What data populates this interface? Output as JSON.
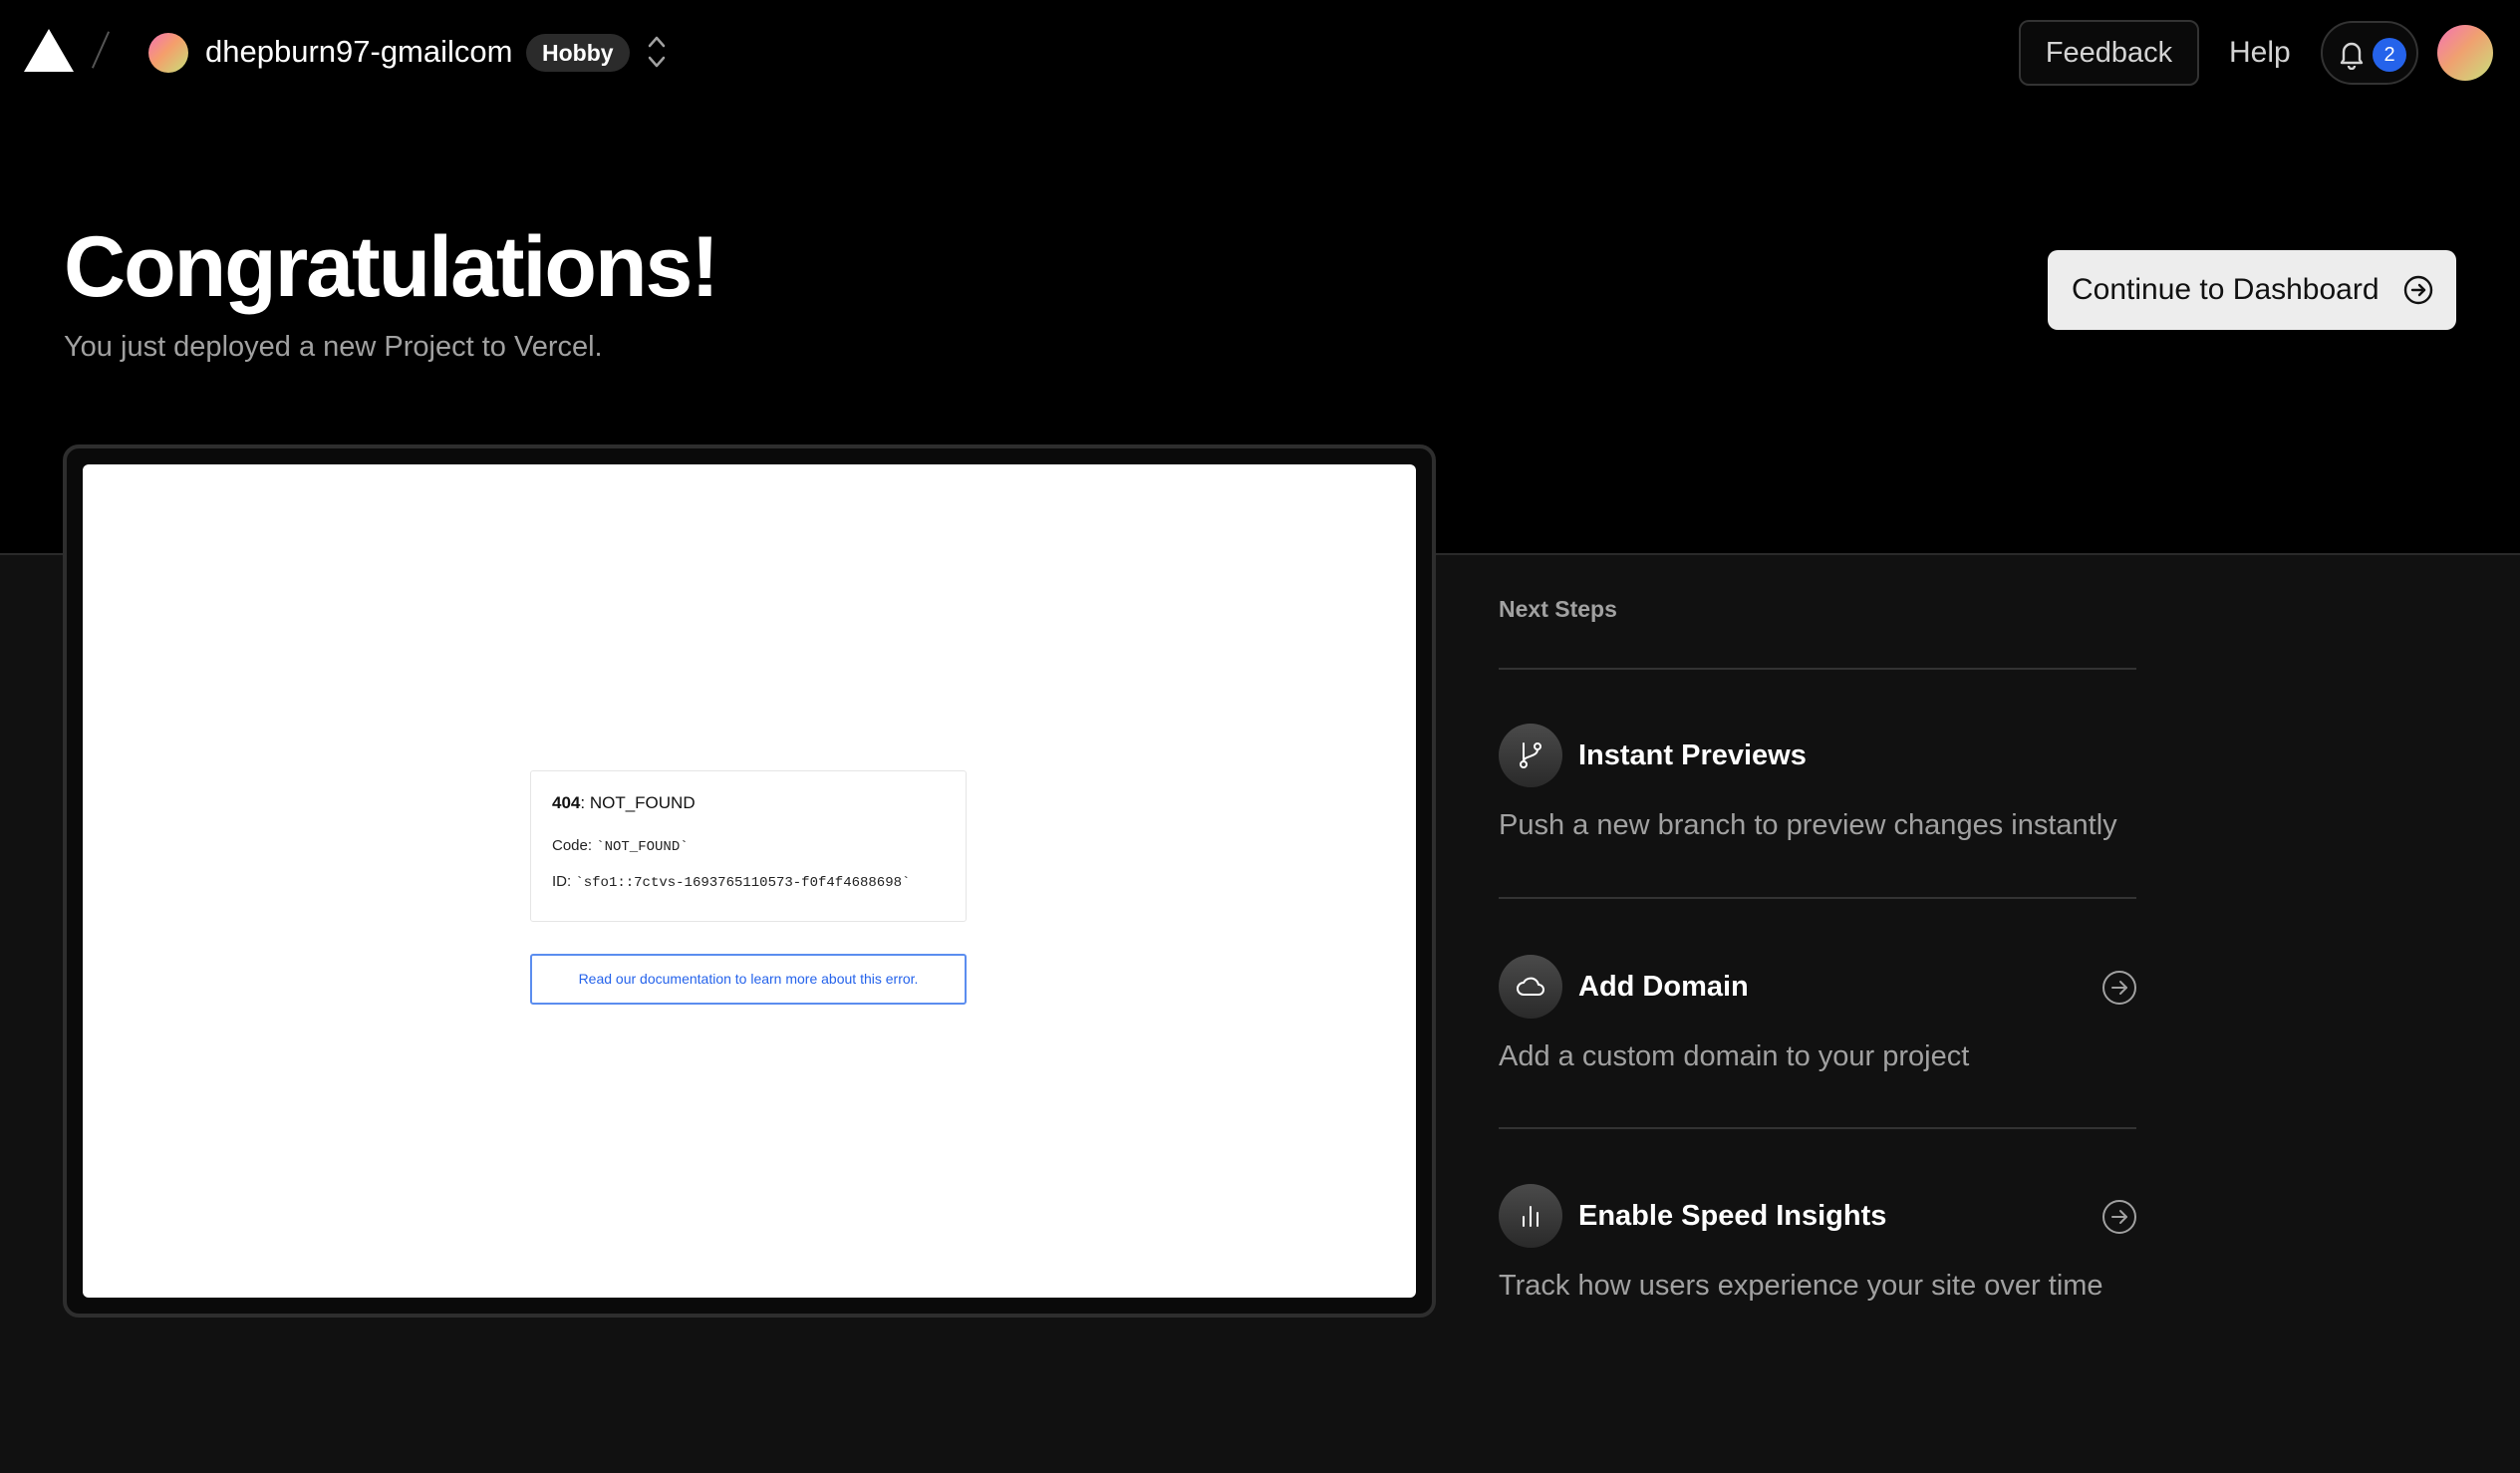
{
  "header": {
    "team_name": "dhepburn97-gmailcom",
    "plan": "Hobby",
    "feedback_label": "Feedback",
    "help_label": "Help",
    "notification_count": "2"
  },
  "hero": {
    "title": "Congratulations!",
    "subtitle": "You just deployed a new Project to Vercel.",
    "dashboard_button": "Continue to Dashboard"
  },
  "preview": {
    "error_code": "404",
    "error_name": ": NOT_FOUND",
    "code_label": "Code: ",
    "code_value": "`NOT_FOUND`",
    "id_label": "ID: ",
    "id_value": "`sfo1::7ctvs-1693765110573-f0f4f4688698`",
    "doc_link": "Read our documentation to learn more about this error."
  },
  "next_steps": {
    "heading": "Next Steps",
    "items": [
      {
        "title": "Instant Previews",
        "description": "Push a new branch to preview changes instantly",
        "icon": "git-branch-icon"
      },
      {
        "title": "Add Domain",
        "description": "Add a custom domain to your project",
        "icon": "cloud-icon"
      },
      {
        "title": "Enable Speed Insights",
        "description": "Track how users experience your site over time",
        "icon": "bar-chart-icon"
      }
    ]
  },
  "colors": {
    "background_top": "#000000",
    "background_bottom": "#111111",
    "accent_blue": "#2563eb",
    "button_light": "#ededed"
  }
}
